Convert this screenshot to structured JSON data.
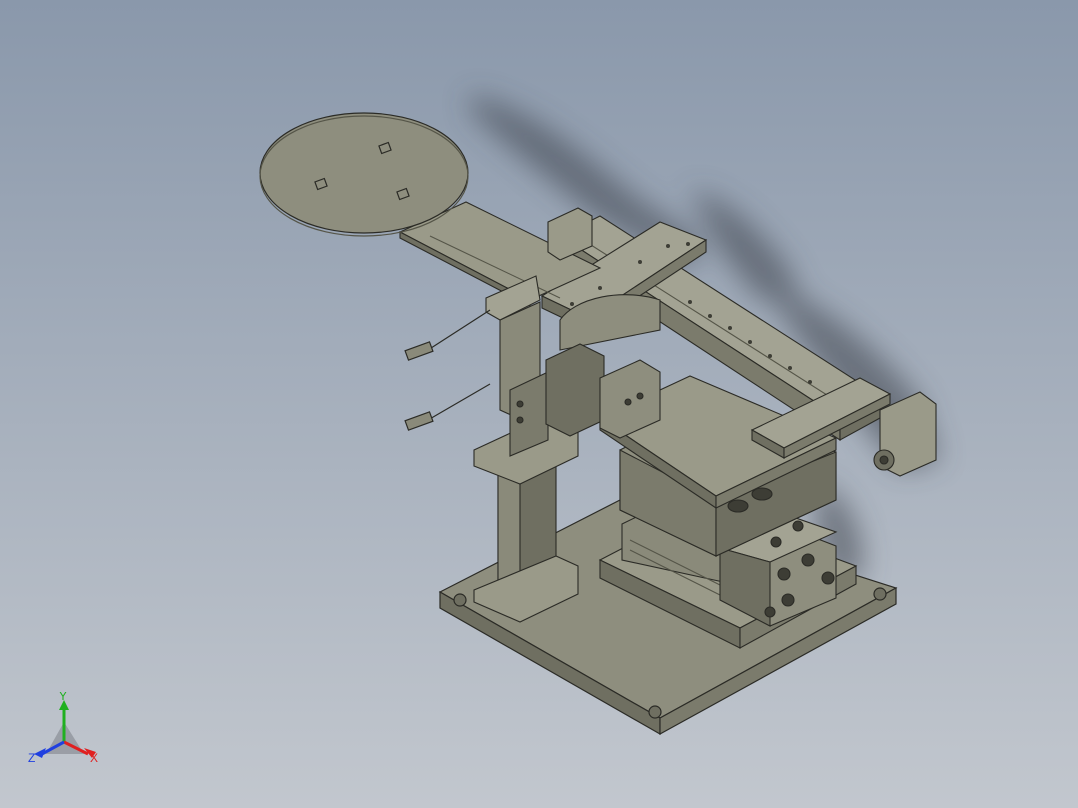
{
  "viewport": {
    "background_top": "#8a98ab",
    "background_bottom": "#c2c7ce"
  },
  "model": {
    "body_color": "#8e8e7e",
    "shade_color": "#6f6f61",
    "light_color": "#a3a393",
    "edge_color": "#2b2b26"
  },
  "triad": {
    "x_label": "X",
    "y_label": "Y",
    "z_label": "Z",
    "x_color": "#e02020",
    "y_color": "#20b020",
    "z_color": "#2040e0"
  }
}
